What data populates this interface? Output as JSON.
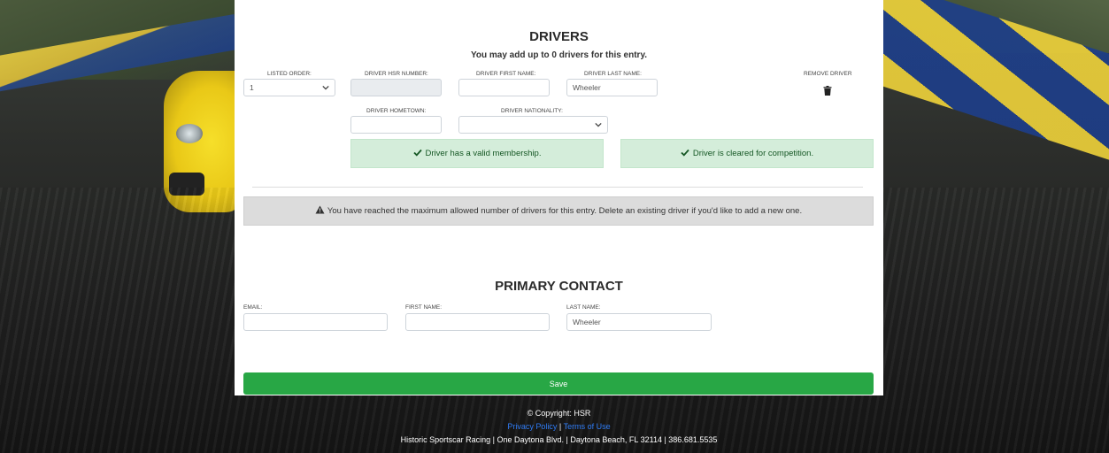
{
  "drivers": {
    "title": "DRIVERS",
    "subtitle": "You may add up to 0 drivers for this entry.",
    "labels": {
      "listed_order": "LISTED ORDER:",
      "hsr_number": "DRIVER HSR NUMBER:",
      "first_name": "DRIVER FIRST NAME:",
      "last_name": "DRIVER LAST NAME:",
      "remove": "REMOVE DRIVER",
      "hometown": "DRIVER HOMETOWN:",
      "nationality": "DRIVER NATIONALITY:"
    },
    "values": {
      "listed_order": "1",
      "hsr_number": "",
      "first_name": "",
      "last_name": "Wheeler",
      "hometown": "",
      "nationality": ""
    },
    "membership_status": "Driver has a valid membership.",
    "competition_status": "Driver is cleared for competition.",
    "max_warning": "You have reached the maximum allowed number of drivers for this entry. Delete an existing driver if you'd like to add a new one."
  },
  "primary_contact": {
    "title": "PRIMARY CONTACT",
    "labels": {
      "email": "EMAIL:",
      "first_name": "FIRST NAME:",
      "last_name": "LAST NAME:"
    },
    "values": {
      "email": "",
      "first_name": "",
      "last_name": "Wheeler"
    }
  },
  "save_label": "Save",
  "footer": {
    "copyright": "© Copyright: HSR",
    "privacy": "Privacy Policy",
    "separator": "|",
    "terms": "Terms of Use",
    "address": "Historic Sportscar Racing | One Daytona Blvd. | Daytona Beach, FL 32114 | 386.681.5535"
  },
  "colors": {
    "success_bg": "#d4edda",
    "success_text": "#155724",
    "warn_bg": "#dcdcdc",
    "save_button": "#28a745",
    "link": "#2f7cf6"
  },
  "icons": [
    "chevron-down-icon",
    "trash-icon",
    "check-icon",
    "warning-icon"
  ]
}
